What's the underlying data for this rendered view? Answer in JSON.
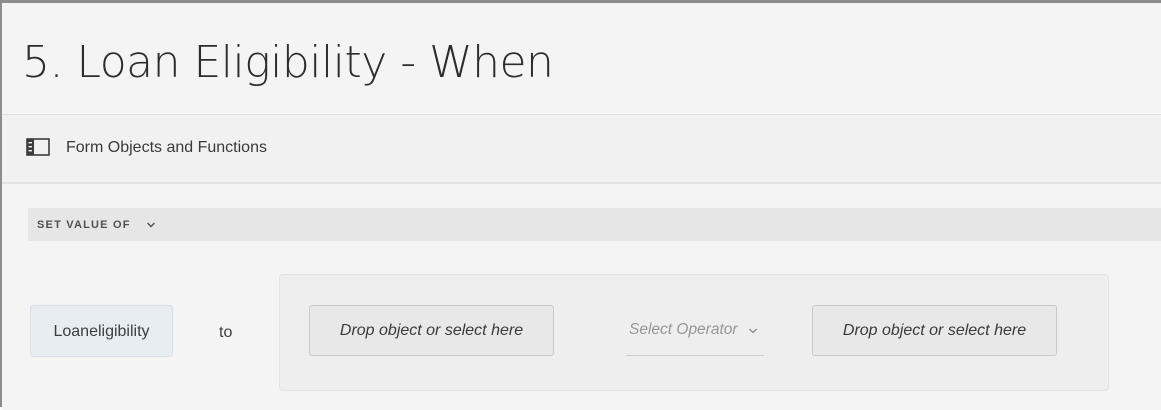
{
  "header": {
    "title": "5. Loan Eligibility - When"
  },
  "objects_panel": {
    "icon": "panel-toggle-icon",
    "label": "Form Objects and Functions"
  },
  "rule": {
    "action_label": "SET VALUE OF",
    "action_icon": "chevron-down-icon",
    "target_field": "Loaneligibility",
    "connector": "to",
    "expression": {
      "left_operand_placeholder": "Drop object or select here",
      "operator_placeholder": "Select Operator",
      "operator_icon": "chevron-down-icon",
      "right_operand_placeholder": "Drop object or select here"
    }
  },
  "colors": {
    "background": "#f4f4f4",
    "chip_background": "#e8edf2",
    "text": "#2c2c2c",
    "placeholder": "#969696"
  }
}
